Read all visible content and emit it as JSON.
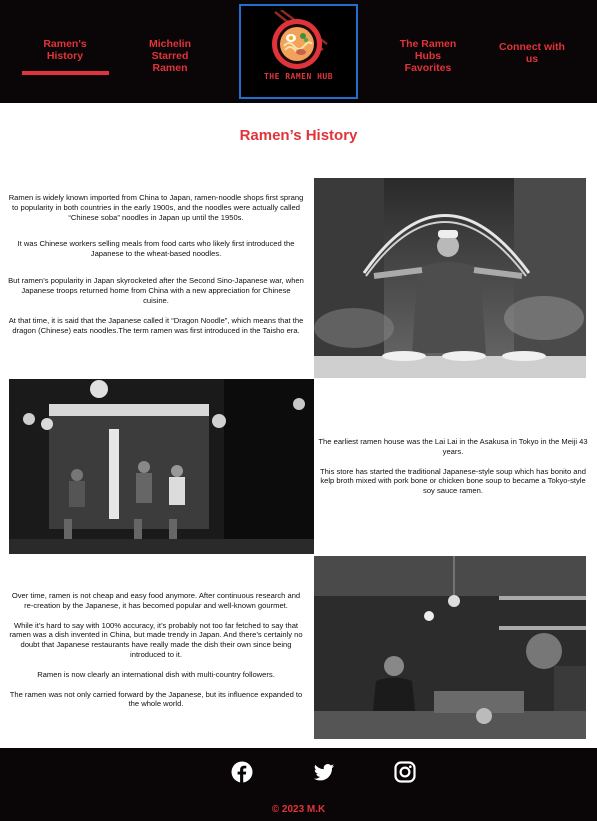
{
  "nav": {
    "items": [
      {
        "label": "Ramen's History"
      },
      {
        "label": "Michelin Starred Ramen"
      },
      {
        "label": "The Ramen Hubs Favorites"
      },
      {
        "label": "Connect with us"
      }
    ],
    "logo_text": "THE RAMEN HUB",
    "accent_color": "#e0343a",
    "logo_border_color": "#1f6fd1"
  },
  "main": {
    "title": "Ramen’s History",
    "block1": [
      "Ramen is widely known imported from China to Japan, ramen-noodle shops first sprang to popularity in both countries in the early 1900s, and the noodles were actually called “Chinese soba” noodles in Japan up until the 1950s.",
      "It was Chinese workers selling meals from food carts who likely first introduced the Japanese to the wheat-based noodles.",
      "But ramen’s popularity in Japan skyrocketed after the Second Sino-Japanese war, when Japanese troops returned home from China with a new appreciation for Chinese cuisine.",
      "At that time, it is said that the Japanese called it “Dragon Noodle”, which means that the dragon (Chinese) eats noodles.The term ramen was first introduced in the Taisho era."
    ],
    "block2": [
      "The earliest ramen house was the Lai Lai in the Asakusa in Tokyo in the Meiji 43 years.",
      "This store has started the traditional Japanese-style soup which has bonito and kelp broth mixed with pork bone or chicken bone soup to became a Tokyo-style soy sauce ramen."
    ],
    "block3": [
      "Over time, ramen is not cheap and easy food anymore. After continuous research and re-creation by the Japanese, it has becomed popular and well-known gourmet.",
      "While it’s hard to say with 100% accuracy, it’s probably not too far fetched to say that ramen was a dish invented in China, but made trendy in Japan. And there’s certainly no doubt that Japanese restaurants have really made the dish their own since being introduced to it.",
      "Ramen is now clearly an international dish with multi-country followers.",
      "The ramen was not only carried forward by the Japanese, but its influence expanded to the whole world."
    ]
  },
  "footer": {
    "social_icons": [
      "facebook-icon",
      "twitter-icon",
      "instagram-icon"
    ],
    "copyright": "© 2023 M.K"
  }
}
